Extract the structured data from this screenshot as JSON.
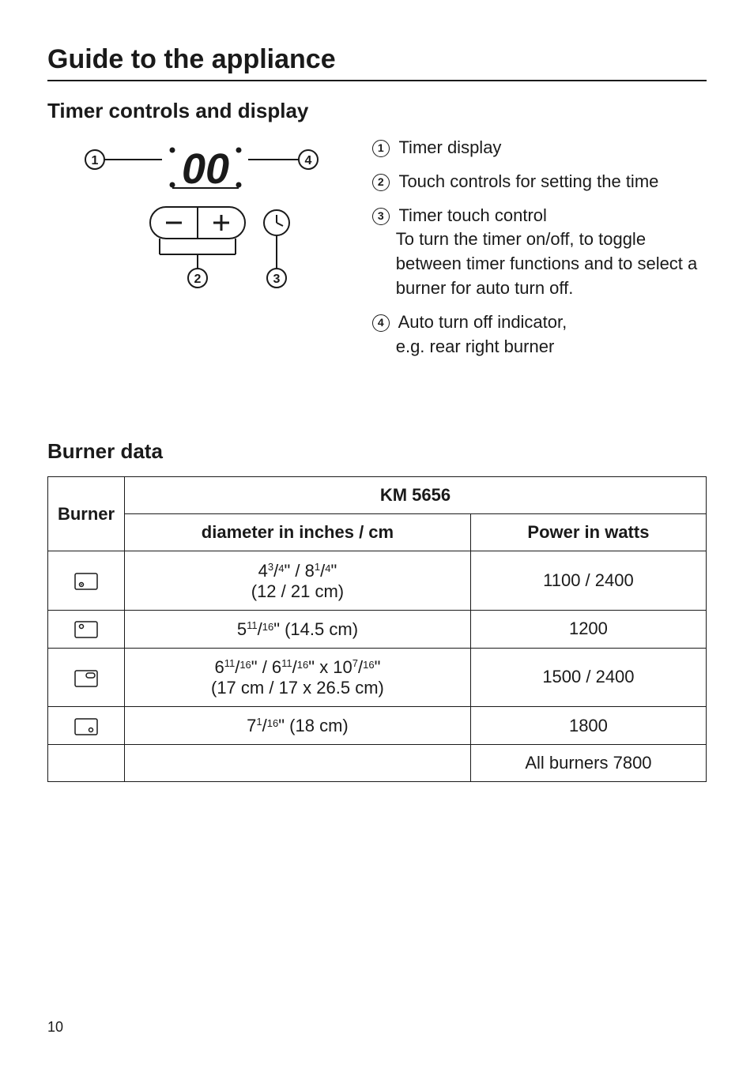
{
  "page_number": "10",
  "title": "Guide to the appliance",
  "section1_heading": "Timer controls and display",
  "timer_diagram": {
    "display_value": "00",
    "callout_1": "1",
    "callout_2": "2",
    "callout_3": "3",
    "callout_4": "4"
  },
  "legend": {
    "item1": {
      "num": "1",
      "text": "Timer display"
    },
    "item2": {
      "num": "2",
      "text": "Touch controls for setting the time"
    },
    "item3": {
      "num": "3",
      "text": "Timer touch control",
      "sub": "To turn the timer on/off, to toggle between timer functions and to select a burner for auto turn off."
    },
    "item4": {
      "num": "4",
      "text": "Auto turn off indicator,",
      "sub": "e.g. rear right burner"
    }
  },
  "section2_heading": "Burner data",
  "table": {
    "burner_header": "Burner",
    "model": "KM 5656",
    "col_diameter": "diameter in inches / cm",
    "col_power": "Power in watts",
    "rows": [
      {
        "icon": "front-left-dual-icon",
        "diameter_line1_parts": [
          "4 ",
          "3",
          "/",
          "4",
          "\" / 8 ",
          "1",
          "/",
          "4",
          "\""
        ],
        "diameter_line2": "(12 / 21 cm)",
        "power": "1100 / 2400"
      },
      {
        "icon": "rear-left-icon",
        "diameter_line1_parts": [
          "5 ",
          "11",
          "/",
          "16",
          "\" (14.5 cm)"
        ],
        "diameter_line2": "",
        "power": "1200"
      },
      {
        "icon": "rear-right-casserole-icon",
        "diameter_line1_parts": [
          "6 ",
          "11",
          "/",
          "16",
          "\" / 6 ",
          "11",
          "/",
          "16",
          "\" x 10 ",
          "7",
          "/",
          "16",
          "\""
        ],
        "diameter_line2": "(17 cm / 17 x 26.5 cm)",
        "power": "1500 / 2400"
      },
      {
        "icon": "front-right-icon",
        "diameter_line1_parts": [
          "7 ",
          "1",
          "/",
          "16",
          "\" (18 cm)"
        ],
        "diameter_line2": "",
        "power": "1800"
      }
    ],
    "total_power": "All burners 7800"
  },
  "chart_data": {
    "type": "table",
    "title": "Burner data — KM 5656",
    "columns": [
      "Burner position",
      "Diameter (inches)",
      "Diameter (cm)",
      "Power (W)"
    ],
    "rows": [
      [
        "Front left (dual zone)",
        "4 3/4 / 8 1/4",
        "12 / 21",
        "1100 / 2400"
      ],
      [
        "Rear left",
        "5 11/16",
        "14.5",
        "1200"
      ],
      [
        "Rear right (extendable)",
        "6 11/16 / 6 11/16 x 10 7/16",
        "17 / 17 x 26.5",
        "1500 / 2400"
      ],
      [
        "Front right",
        "7 1/16",
        "18",
        "1800"
      ],
      [
        "All burners total",
        "",
        "",
        "7800"
      ]
    ],
    "timer_legend": [
      {
        "callout": 1,
        "label": "Timer display"
      },
      {
        "callout": 2,
        "label": "Touch controls for setting the time"
      },
      {
        "callout": 3,
        "label": "Timer touch control"
      },
      {
        "callout": 4,
        "label": "Auto turn off indicator"
      }
    ]
  }
}
